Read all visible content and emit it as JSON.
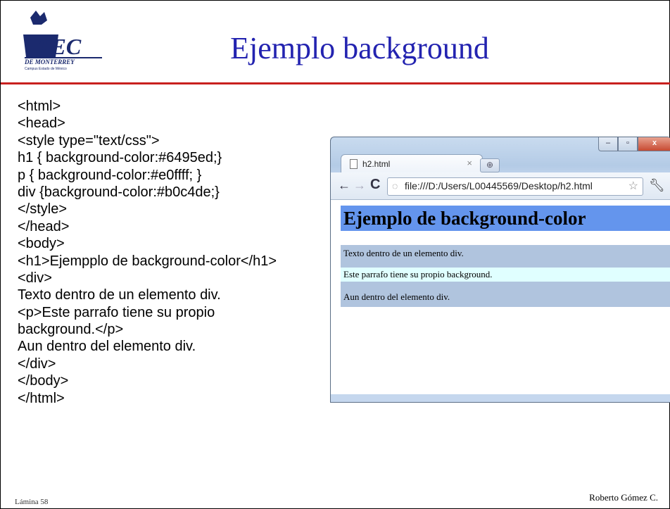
{
  "logo": {
    "text": "TEC",
    "subtitle": "DE MONTERREY",
    "campus": "Campus Estado de México"
  },
  "slide": {
    "title": "Ejemplo background"
  },
  "code_lines": [
    "<html>",
    "<head>",
    "<style type=\"text/css\">",
    "h1 { background-color:#6495ed;}",
    "p { background-color:#e0ffff; }",
    "div {background-color:#b0c4de;}",
    "</style>",
    "</head>",
    "<body>",
    "<h1>Ejempplo de background-color</h1>",
    "<div>",
    "Texto dentro de un elemento div.",
    "<p>Este parrafo tiene su propio",
    "background.</p>",
    "Aun dentro del elemento div.",
    "</div>",
    "</body>",
    "</html>"
  ],
  "browser": {
    "tab_title": "h2.html",
    "tab_close": "×",
    "url": "file:///D:/Users/L00445569/Desktop/h2.html",
    "page": {
      "h1": "Ejemplo de background-color",
      "div_text1": "Texto dentro de un elemento div.",
      "p_text": "Este parrafo tiene su propio background.",
      "div_text2": "Aun dentro del elemento div."
    }
  },
  "footer": {
    "left": "Lámina 58",
    "right": "Roberto Gómez C."
  },
  "colors": {
    "title": "#2323b0",
    "rule": "#c8211f",
    "h1_bg": "#6495ed",
    "p_bg": "#e0ffff",
    "div_bg": "#b0c4de"
  }
}
